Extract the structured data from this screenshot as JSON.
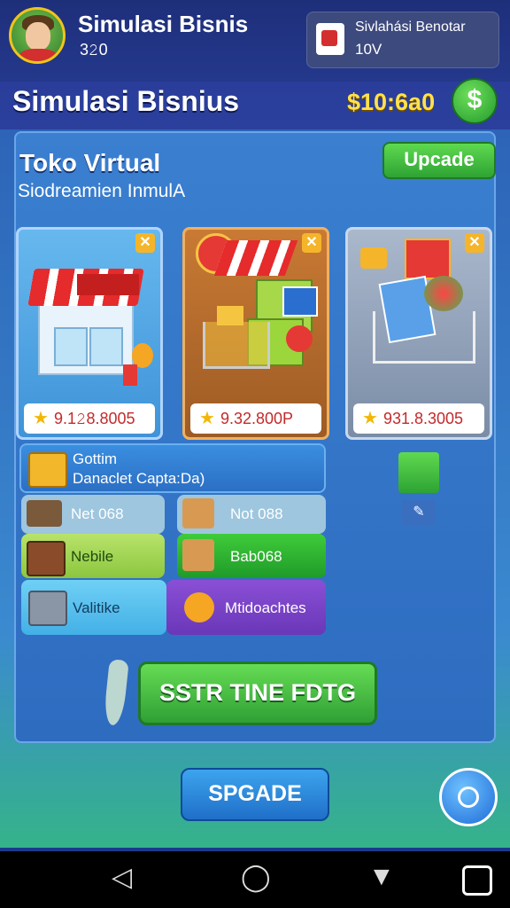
{
  "top_bar": {
    "title": "Simulasi Bisnis",
    "score": "3𝟸0",
    "notification": {
      "title": "Sivlahási Benotar",
      "value": "10V"
    }
  },
  "header": {
    "title": "Simulasi Bisnius",
    "money": "$10:6a0",
    "money_button_icon": "dollar-icon"
  },
  "store": {
    "title": "Toko Virtual",
    "subtitle": "Siodreamien InmulA",
    "upgrade_label": "Upcade",
    "cards": [
      {
        "name": "shop-building",
        "price": "9.1𝟸8.8005"
      },
      {
        "name": "shopping-cart-goods",
        "price": "9.32.800P"
      },
      {
        "name": "cart-full-products",
        "price": "931.8.3005"
      }
    ],
    "list": [
      {
        "title": "Gottim",
        "subtitle": "Danaclet Capta:Da)"
      },
      {
        "left": "Net 068",
        "right": "Not 088"
      },
      {
        "left": "Nebile",
        "right": "Bab068"
      },
      {
        "left": "Valitike",
        "right": "Mtidoachtes"
      }
    ],
    "start_label": "SSTR TINE FDTG"
  },
  "bottom": {
    "button_label": "SPGADE"
  },
  "colors": {
    "accent_green": "#2ea334",
    "header_blue": "#24388c",
    "money_gold": "#ffe14d"
  }
}
